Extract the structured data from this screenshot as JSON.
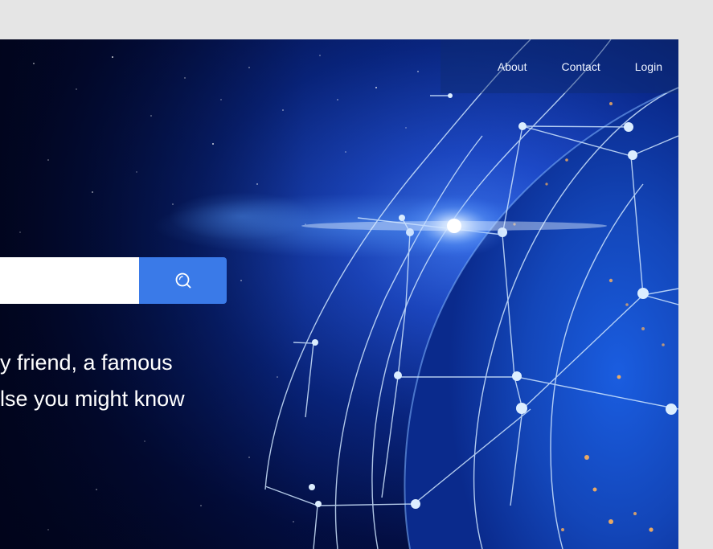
{
  "nav": {
    "items": [
      {
        "label": "About"
      },
      {
        "label": "Contact"
      },
      {
        "label": "Login"
      }
    ]
  },
  "search": {
    "value": "",
    "placeholder": "",
    "button_icon": "search-icon"
  },
  "hero": {
    "tagline_lines": [
      "y friend, a famous",
      "lse you might know"
    ]
  },
  "colors": {
    "accent": "#3a7ae8",
    "page_background": "#e5e5e5",
    "hero_deep": "#03104a",
    "hero_glow": "#3f7cff"
  }
}
